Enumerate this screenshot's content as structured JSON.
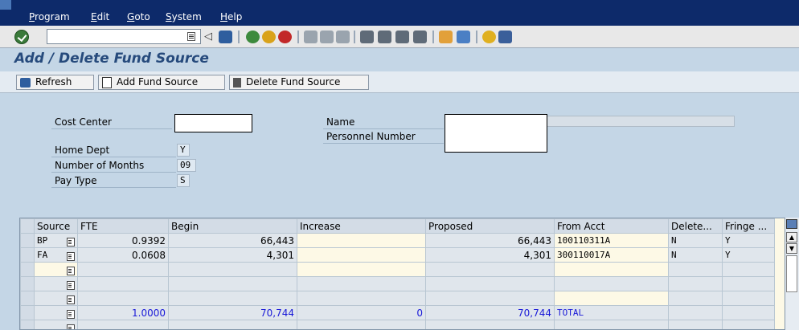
{
  "menu": [
    "Program",
    "Edit",
    "Goto",
    "System",
    "Help"
  ],
  "system_toolbar": {
    "command_field_value": "",
    "icons": [
      "enter-icon",
      "dropdown-icon",
      "back-arrow-icon",
      "save-icon",
      "back-icon",
      "exit-icon",
      "cancel-icon",
      "print-icon",
      "find-icon",
      "find-next-icon",
      "first-page-icon",
      "previous-page-icon",
      "next-page-icon",
      "last-page-icon",
      "create-session-icon",
      "shortcut-icon",
      "help-icon",
      "layout-icon"
    ]
  },
  "page_title": "Add / Delete Fund Source",
  "app_toolbar": {
    "refresh": "Refresh",
    "add": "Add Fund Source",
    "delete": "Delete Fund Source"
  },
  "form": {
    "cost_center_label": "Cost Center",
    "cost_center_value": "",
    "name_label": "Name",
    "name_value": "",
    "personnel_label": "Personnel Number",
    "personnel_value": "",
    "home_dept_label": "Home Dept",
    "home_dept_value": "Y",
    "months_label": "Number of Months",
    "months_value": "09",
    "paytype_label": "Pay Type",
    "paytype_value": "S"
  },
  "table": {
    "columns": [
      "Source",
      "FTE",
      "Begin",
      "Increase",
      "Proposed",
      "From Acct",
      "Delete...",
      "Fringe ..."
    ],
    "rows": [
      {
        "source": "BP",
        "fte": "0.9392",
        "begin": "66,443",
        "increase": "",
        "proposed": "66,443",
        "from_acct": "100110311A",
        "delete": "N",
        "fringe": "Y"
      },
      {
        "source": "FA",
        "fte": "0.0608",
        "begin": "4,301",
        "increase": "",
        "proposed": "4,301",
        "from_acct": "300110017A",
        "delete": "N",
        "fringe": "Y"
      },
      {
        "source": "",
        "fte": "",
        "begin": "",
        "increase": "",
        "proposed": "",
        "from_acct": "",
        "delete": "",
        "fringe": ""
      },
      {
        "source": "",
        "fte": "",
        "begin": "",
        "increase": "",
        "proposed": "",
        "from_acct": "",
        "delete": "",
        "fringe": ""
      },
      {
        "source": "",
        "fte": "",
        "begin": "",
        "increase": "",
        "proposed": "",
        "from_acct": "",
        "delete": "",
        "fringe": ""
      },
      {
        "source": "",
        "fte": "1.0000",
        "begin": "70,744",
        "increase": "0",
        "proposed": "70,744",
        "from_acct": "TOTAL",
        "delete": "",
        "fringe": ""
      },
      {
        "source": "",
        "fte": "",
        "begin": "",
        "increase": "",
        "proposed": "",
        "from_acct": "",
        "delete": "",
        "fringe": ""
      }
    ]
  },
  "colors": {
    "menu_bar": "#0d2a6a",
    "title": "#264a7c",
    "background": "#c4d6e6",
    "total_text": "#1a1ad8"
  }
}
